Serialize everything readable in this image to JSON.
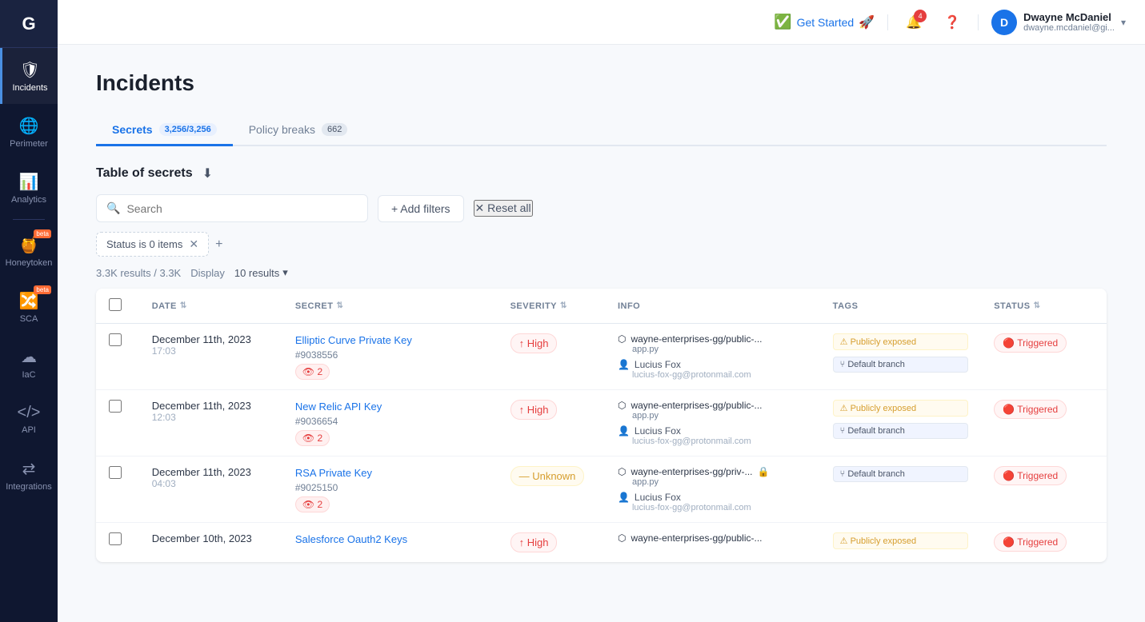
{
  "sidebar": {
    "logo": "G",
    "items": [
      {
        "id": "incidents",
        "label": "Incidents",
        "icon": "🛡",
        "active": true,
        "beta": false
      },
      {
        "id": "perimeter",
        "label": "Perimeter",
        "icon": "🌐",
        "active": false,
        "beta": false
      },
      {
        "id": "analytics",
        "label": "Analytics",
        "icon": "📊",
        "active": false,
        "beta": false
      },
      {
        "id": "honeytoken",
        "label": "Honeytoken",
        "icon": "🔗",
        "active": false,
        "beta": true
      },
      {
        "id": "sca",
        "label": "SCA",
        "icon": "🔀",
        "active": false,
        "beta": true
      },
      {
        "id": "iac",
        "label": "IaC",
        "icon": "☁",
        "active": false,
        "beta": false
      },
      {
        "id": "api",
        "label": "API",
        "icon": "⟨⟩",
        "active": false,
        "beta": false
      },
      {
        "id": "integrations",
        "label": "Integrations",
        "icon": "⇄",
        "active": false,
        "beta": false
      }
    ]
  },
  "topbar": {
    "get_started": "Get Started",
    "notification_count": "4",
    "user_name": "Dwayne McDaniel",
    "user_email": "dwayne.mcdaniel@gi...",
    "user_initial": "D"
  },
  "page": {
    "title": "Incidents",
    "tabs": [
      {
        "id": "secrets",
        "label": "Secrets",
        "badge": "3,256/3,256",
        "active": true
      },
      {
        "id": "policy_breaks",
        "label": "Policy breaks",
        "badge": "662",
        "active": false
      }
    ],
    "section_title": "Table of secrets",
    "search_placeholder": "Search",
    "add_filters_label": "+ Add filters",
    "reset_all_label": "✕ Reset all",
    "filter_tag": "Status is 0 items",
    "results_text": "3.3K results / 3.3K",
    "display_label": "Display",
    "display_value": "10 results",
    "columns": {
      "date": "DATE",
      "secret": "SECRET",
      "severity": "SEVERITY",
      "info": "INFO",
      "tags": "TAGS",
      "status": "STATUS"
    },
    "rows": [
      {
        "date": "December 11th, 2023",
        "time": "17:03",
        "secret_name": "Elliptic Curve Private Key",
        "secret_id": "#9038556",
        "views": "2",
        "severity": "High",
        "severity_type": "high",
        "repo": "wayne-enterprises-gg/public-...",
        "file": "app.py",
        "user": "Lucius Fox",
        "email": "lucius-fox-gg@protonmail.com",
        "tags": [
          "Publicly exposed",
          "Default branch"
        ],
        "status": "Triggered",
        "has_lock": false
      },
      {
        "date": "December 11th, 2023",
        "time": "12:03",
        "secret_name": "New Relic API Key",
        "secret_id": "#9036654",
        "views": "2",
        "severity": "High",
        "severity_type": "high",
        "repo": "wayne-enterprises-gg/public-...",
        "file": "app.py",
        "user": "Lucius Fox",
        "email": "lucius-fox-gg@protonmail.com",
        "tags": [
          "Publicly exposed",
          "Default branch"
        ],
        "status": "Triggered",
        "has_lock": false
      },
      {
        "date": "December 11th, 2023",
        "time": "04:03",
        "secret_name": "RSA Private Key",
        "secret_id": "#9025150",
        "views": "2",
        "severity": "Unknown",
        "severity_type": "unknown",
        "repo": "wayne-enterprises-gg/priv-...",
        "file": "app.py",
        "user": "Lucius Fox",
        "email": "lucius-fox-gg@protonmail.com",
        "tags": [
          "Default branch"
        ],
        "status": "Triggered",
        "has_lock": true
      },
      {
        "date": "December 10th, 2023",
        "time": "",
        "secret_name": "Salesforce Oauth2 Keys",
        "secret_id": "",
        "views": "",
        "severity": "High",
        "severity_type": "high",
        "repo": "wayne-enterprises-gg/public-...",
        "file": "",
        "user": "",
        "email": "",
        "tags": [
          "Publicly exposed"
        ],
        "status": "Triggered",
        "has_lock": false
      }
    ]
  }
}
